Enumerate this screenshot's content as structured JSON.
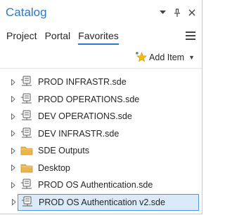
{
  "pane": {
    "title": "Catalog",
    "controls": {
      "menu_glyph": "▾",
      "pin_glyph": "⊥",
      "close_glyph": "✕"
    }
  },
  "tabs": [
    {
      "label": "Project",
      "active": false
    },
    {
      "label": "Portal",
      "active": false
    },
    {
      "label": "Favorites",
      "active": true
    }
  ],
  "toolbar": {
    "add_item_label": "Add Item"
  },
  "tree": {
    "items": [
      {
        "label": "PROD INFRASTR.sde",
        "icon": "database-connection-icon",
        "selected": false
      },
      {
        "label": "PROD OPERATIONS.sde",
        "icon": "database-connection-icon",
        "selected": false
      },
      {
        "label": "DEV OPERATIONS.sde",
        "icon": "database-connection-icon",
        "selected": false
      },
      {
        "label": "DEV INFRASTR.sde",
        "icon": "database-connection-icon",
        "selected": false
      },
      {
        "label": "SDE Outputs",
        "icon": "folder-icon",
        "selected": false
      },
      {
        "label": "Desktop",
        "icon": "folder-icon",
        "selected": false
      },
      {
        "label": "PROD OS Authentication.sde",
        "icon": "database-connection-icon",
        "selected": false
      },
      {
        "label": "PROD OS Authentication v2.sde",
        "icon": "database-connection-icon",
        "selected": true
      }
    ]
  },
  "colors": {
    "accent": "#2b79c8",
    "selection_bg": "#dbeaf8",
    "selection_border": "#4a9ae0",
    "folder": "#e8b64c"
  }
}
